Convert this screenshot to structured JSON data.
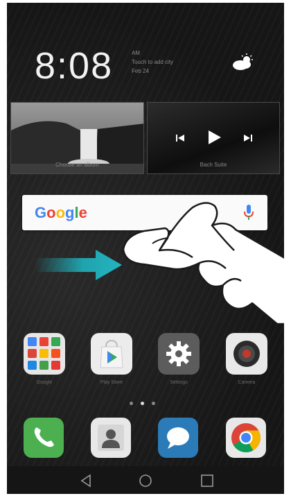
{
  "status": {
    "time": "8:08",
    "weather_lines": [
      "AM",
      "Touch to add city",
      "Feb 24"
    ],
    "weather_icon": "partly-cloudy-icon"
  },
  "widgets": {
    "gallery_caption": "Choose an album",
    "music_caption": "Bach Suite",
    "music_controls": [
      "previous-icon",
      "play-icon",
      "next-icon"
    ]
  },
  "search": {
    "logo_letters": [
      "G",
      "o",
      "o",
      "g",
      "l",
      "e"
    ],
    "logo_colors": [
      "#4285F4",
      "#EA4335",
      "#FBBC05",
      "#4285F4",
      "#34A853",
      "#EA4335"
    ],
    "mic_icon": "mic-icon"
  },
  "gesture": {
    "arrow_color": "#1fa3ad",
    "hint": "swipe-right-gesture"
  },
  "apps": [
    {
      "label": "Google",
      "icon": "google-folder-icon"
    },
    {
      "label": "Play Store",
      "icon": "play-store-icon"
    },
    {
      "label": "Settings",
      "icon": "settings-gear-icon"
    },
    {
      "label": "Camera",
      "icon": "camera-icon"
    }
  ],
  "page_indicator": {
    "count": 3,
    "active": 1
  },
  "dock": [
    {
      "icon": "phone-icon",
      "color": "#4caf50"
    },
    {
      "icon": "contacts-icon",
      "color": "#e8e8e8"
    },
    {
      "icon": "messages-icon",
      "color": "#2a7bb8"
    },
    {
      "icon": "chrome-icon",
      "color": "#e8e8e8"
    }
  ],
  "navbar": [
    "back-icon",
    "home-icon",
    "recents-icon"
  ]
}
